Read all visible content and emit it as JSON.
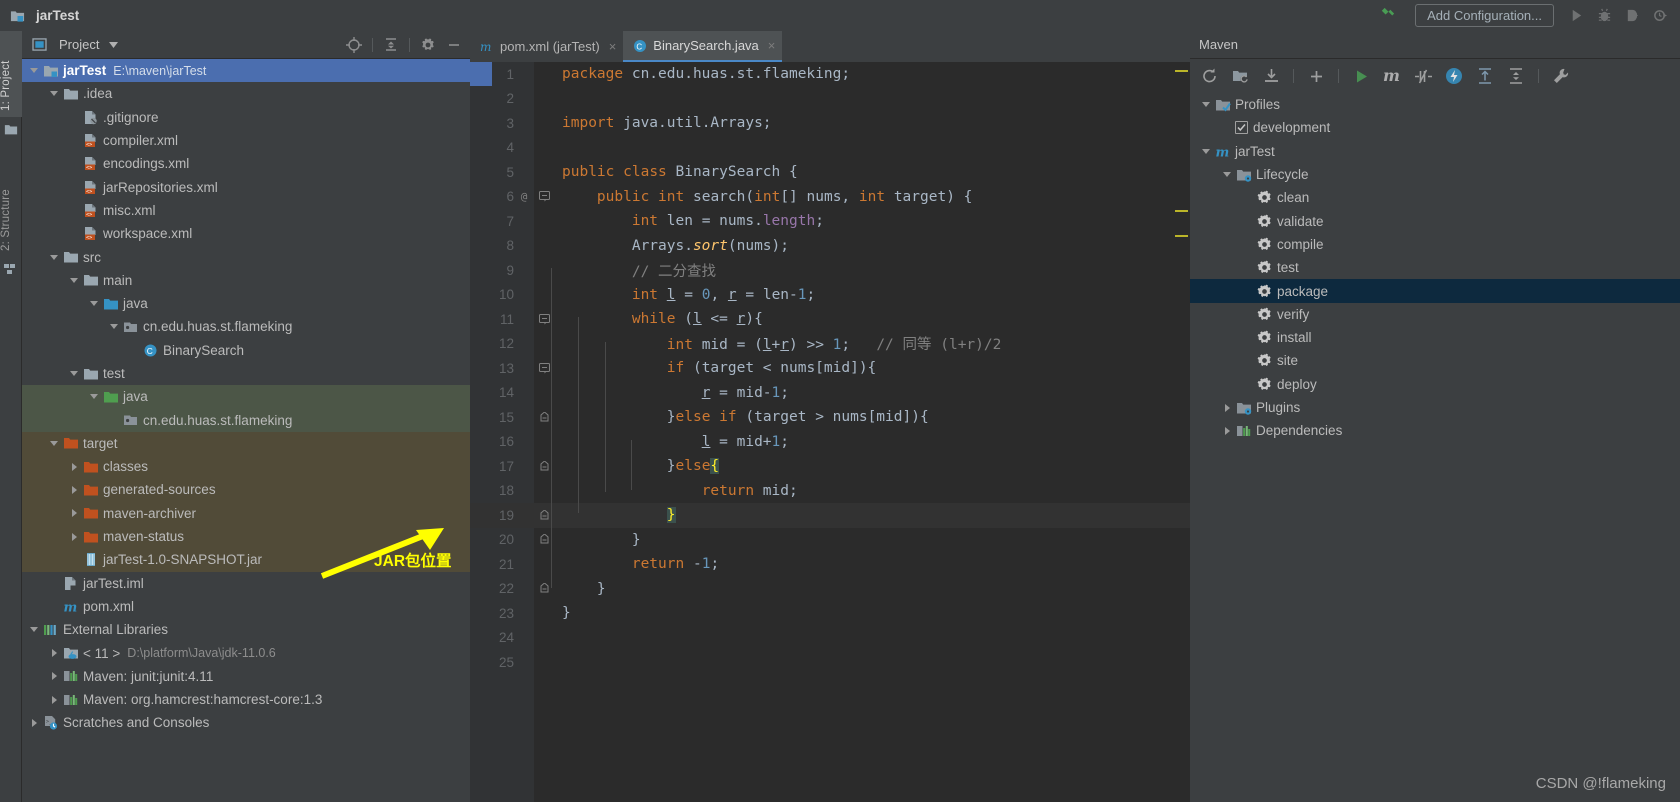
{
  "window": {
    "project_name": "jarTest",
    "add_configuration_label": "Add Configuration...",
    "icons": [
      "hammer-icon",
      "run-icon",
      "debug-icon",
      "coverage-icon",
      "profile-icon"
    ]
  },
  "left_rail": {
    "tabs": [
      {
        "label": "1: Project",
        "icon": "project-icon",
        "active": true
      },
      {
        "label": "2: Structure",
        "icon": "structure-icon",
        "active": false
      }
    ]
  },
  "project_panel": {
    "title": "Project",
    "toolbar": [
      "locate-icon",
      "collapse-all-icon",
      "settings-icon",
      "hide-icon"
    ],
    "tree": [
      {
        "indent": 0,
        "arrow": "down",
        "icon": "module-folder-icon",
        "label": "jarTest",
        "path": "E:\\maven\\jarTest",
        "selected": true,
        "bold": true
      },
      {
        "indent": 1,
        "arrow": "down",
        "icon": "folder-icon",
        "label": ".idea"
      },
      {
        "indent": 2,
        "arrow": "none",
        "icon": "gitignore-icon",
        "label": ".gitignore"
      },
      {
        "indent": 2,
        "arrow": "none",
        "icon": "xml-icon",
        "label": "compiler.xml"
      },
      {
        "indent": 2,
        "arrow": "none",
        "icon": "xml-icon",
        "label": "encodings.xml"
      },
      {
        "indent": 2,
        "arrow": "none",
        "icon": "xml-icon",
        "label": "jarRepositories.xml"
      },
      {
        "indent": 2,
        "arrow": "none",
        "icon": "xml-icon",
        "label": "misc.xml"
      },
      {
        "indent": 2,
        "arrow": "none",
        "icon": "xml-icon",
        "label": "workspace.xml"
      },
      {
        "indent": 1,
        "arrow": "down",
        "icon": "folder-icon",
        "label": "src"
      },
      {
        "indent": 2,
        "arrow": "down",
        "icon": "folder-icon",
        "label": "main"
      },
      {
        "indent": 3,
        "arrow": "down",
        "icon": "source-folder-icon",
        "label": "java"
      },
      {
        "indent": 4,
        "arrow": "down",
        "icon": "package-icon",
        "label": "cn.edu.huas.st.flameking"
      },
      {
        "indent": 5,
        "arrow": "none",
        "icon": "class-icon",
        "label": "BinarySearch"
      },
      {
        "indent": 2,
        "arrow": "down",
        "icon": "folder-icon",
        "label": "test"
      },
      {
        "indent": 3,
        "arrow": "down",
        "icon": "test-source-folder-icon",
        "label": "java",
        "bg": "green"
      },
      {
        "indent": 4,
        "arrow": "none",
        "icon": "package-icon",
        "label": "cn.edu.huas.st.flameking",
        "bg": "green"
      },
      {
        "indent": 1,
        "arrow": "down",
        "icon": "excluded-folder-icon",
        "label": "target",
        "bg": "brown"
      },
      {
        "indent": 2,
        "arrow": "right",
        "icon": "excluded-folder-icon",
        "label": "classes",
        "bg": "brown"
      },
      {
        "indent": 2,
        "arrow": "right",
        "icon": "excluded-folder-icon",
        "label": "generated-sources",
        "bg": "brown"
      },
      {
        "indent": 2,
        "arrow": "right",
        "icon": "excluded-folder-icon",
        "label": "maven-archiver",
        "bg": "brown"
      },
      {
        "indent": 2,
        "arrow": "right",
        "icon": "excluded-folder-icon",
        "label": "maven-status",
        "bg": "brown"
      },
      {
        "indent": 2,
        "arrow": "none",
        "icon": "jar-icon",
        "label": "jarTest-1.0-SNAPSHOT.jar",
        "bg": "brown"
      },
      {
        "indent": 1,
        "arrow": "none",
        "icon": "iml-icon",
        "label": "jarTest.iml"
      },
      {
        "indent": 1,
        "arrow": "none",
        "icon": "maven-pom-icon",
        "label": "pom.xml"
      },
      {
        "indent": 0,
        "arrow": "down",
        "icon": "libraries-icon",
        "label": "External Libraries"
      },
      {
        "indent": 1,
        "arrow": "right",
        "icon": "jdk-icon",
        "label": "< 11 >",
        "path": "D:\\platform\\Java\\jdk-11.0.6"
      },
      {
        "indent": 1,
        "arrow": "right",
        "icon": "library-icon",
        "label": "Maven: junit:junit:4.11"
      },
      {
        "indent": 1,
        "arrow": "right",
        "icon": "library-icon",
        "label": "Maven: org.hamcrest:hamcrest-core:1.3"
      },
      {
        "indent": 0,
        "arrow": "right",
        "icon": "scratches-icon",
        "label": "Scratches and Consoles"
      }
    ]
  },
  "annotation": {
    "text": "JAR包位置",
    "color": "#ffff00"
  },
  "editor": {
    "tabs": [
      {
        "label": "pom.xml (jarTest)",
        "icon": "maven-pom-icon",
        "active": false,
        "close": "×"
      },
      {
        "label": "BinarySearch.java",
        "icon": "class-icon",
        "active": true,
        "close": "×"
      }
    ],
    "current_line": 19,
    "lines": [
      {
        "n": 1,
        "indent": 0,
        "text": "package cn.edu.huas.st.flameking;"
      },
      {
        "n": 2,
        "indent": 0,
        "text": ""
      },
      {
        "n": 3,
        "indent": 0,
        "text": "import java.util.Arrays;"
      },
      {
        "n": 4,
        "indent": 0,
        "text": ""
      },
      {
        "n": 5,
        "indent": 0,
        "text": "public class BinarySearch {"
      },
      {
        "n": 6,
        "indent": 1,
        "text": "public int search(int[] nums, int target) {",
        "gutter": "@",
        "fold": "minus"
      },
      {
        "n": 7,
        "indent": 2,
        "text": "int len = nums.length;"
      },
      {
        "n": 8,
        "indent": 2,
        "text": "Arrays.sort(nums);"
      },
      {
        "n": 9,
        "indent": 2,
        "text": "// 二分查找"
      },
      {
        "n": 10,
        "indent": 2,
        "text": "int l = 0, r = len-1;"
      },
      {
        "n": 11,
        "indent": 2,
        "text": "while (l <= r){",
        "fold": "minus"
      },
      {
        "n": 12,
        "indent": 3,
        "text": "int mid = (l+r) >> 1;   // 同等 (l+r)/2"
      },
      {
        "n": 13,
        "indent": 3,
        "text": "if (target < nums[mid]){",
        "fold": "minus"
      },
      {
        "n": 14,
        "indent": 4,
        "text": "r = mid-1;"
      },
      {
        "n": 15,
        "indent": 3,
        "text": "}else if (target > nums[mid]){",
        "fold": "end"
      },
      {
        "n": 16,
        "indent": 4,
        "text": "l = mid+1;"
      },
      {
        "n": 17,
        "indent": 3,
        "text": "}else{",
        "fold": "end"
      },
      {
        "n": 18,
        "indent": 4,
        "text": "return mid;"
      },
      {
        "n": 19,
        "indent": 3,
        "text": "}",
        "fold": "end",
        "current": true
      },
      {
        "n": 20,
        "indent": 2,
        "text": "}",
        "fold": "end"
      },
      {
        "n": 21,
        "indent": 2,
        "text": "return -1;"
      },
      {
        "n": 22,
        "indent": 1,
        "text": "}",
        "fold": "end"
      },
      {
        "n": 23,
        "indent": 0,
        "text": "}"
      },
      {
        "n": 24,
        "indent": 0,
        "text": ""
      },
      {
        "n": 25,
        "indent": 0,
        "text": ""
      }
    ]
  },
  "maven_panel": {
    "title": "Maven",
    "toolbar": [
      "reimport-icon",
      "generate-sources-icon",
      "download-sources-icon",
      "add-icon",
      "run-icon",
      "maven-m-icon",
      "skip-tests-icon",
      "execute-goal-icon",
      "expand-icon",
      "collapse-icon",
      "settings-wrench-icon"
    ],
    "tree": [
      {
        "indent": 0,
        "arrow": "down",
        "icon": "profiles-icon",
        "label": "Profiles"
      },
      {
        "indent": 1,
        "arrow": "none",
        "icon": "checkbox",
        "label": "development",
        "checked": true
      },
      {
        "indent": 0,
        "arrow": "down",
        "icon": "maven-pom-icon",
        "label": "jarTest"
      },
      {
        "indent": 1,
        "arrow": "down",
        "icon": "lifecycle-icon",
        "label": "Lifecycle"
      },
      {
        "indent": 2,
        "arrow": "none",
        "icon": "goal-icon",
        "label": "clean"
      },
      {
        "indent": 2,
        "arrow": "none",
        "icon": "goal-icon",
        "label": "validate"
      },
      {
        "indent": 2,
        "arrow": "none",
        "icon": "goal-icon",
        "label": "compile"
      },
      {
        "indent": 2,
        "arrow": "none",
        "icon": "goal-icon",
        "label": "test"
      },
      {
        "indent": 2,
        "arrow": "none",
        "icon": "goal-icon",
        "label": "package",
        "selected": true
      },
      {
        "indent": 2,
        "arrow": "none",
        "icon": "goal-icon",
        "label": "verify"
      },
      {
        "indent": 2,
        "arrow": "none",
        "icon": "goal-icon",
        "label": "install"
      },
      {
        "indent": 2,
        "arrow": "none",
        "icon": "goal-icon",
        "label": "site"
      },
      {
        "indent": 2,
        "arrow": "none",
        "icon": "goal-icon",
        "label": "deploy"
      },
      {
        "indent": 1,
        "arrow": "right",
        "icon": "plugins-icon",
        "label": "Plugins"
      },
      {
        "indent": 1,
        "arrow": "right",
        "icon": "dependencies-icon",
        "label": "Dependencies"
      }
    ]
  },
  "watermark": {
    "text": "CSDN @!flameking"
  },
  "colors": {
    "selection_blue": "#4b6eaf",
    "maven_selection": "#0d293e",
    "test_source_green": "#4c5647",
    "excluded_brown": "#514b38",
    "keyword_orange": "#cc7832",
    "comment_gray": "#808080",
    "annotation_yellow": "#ffff00"
  }
}
